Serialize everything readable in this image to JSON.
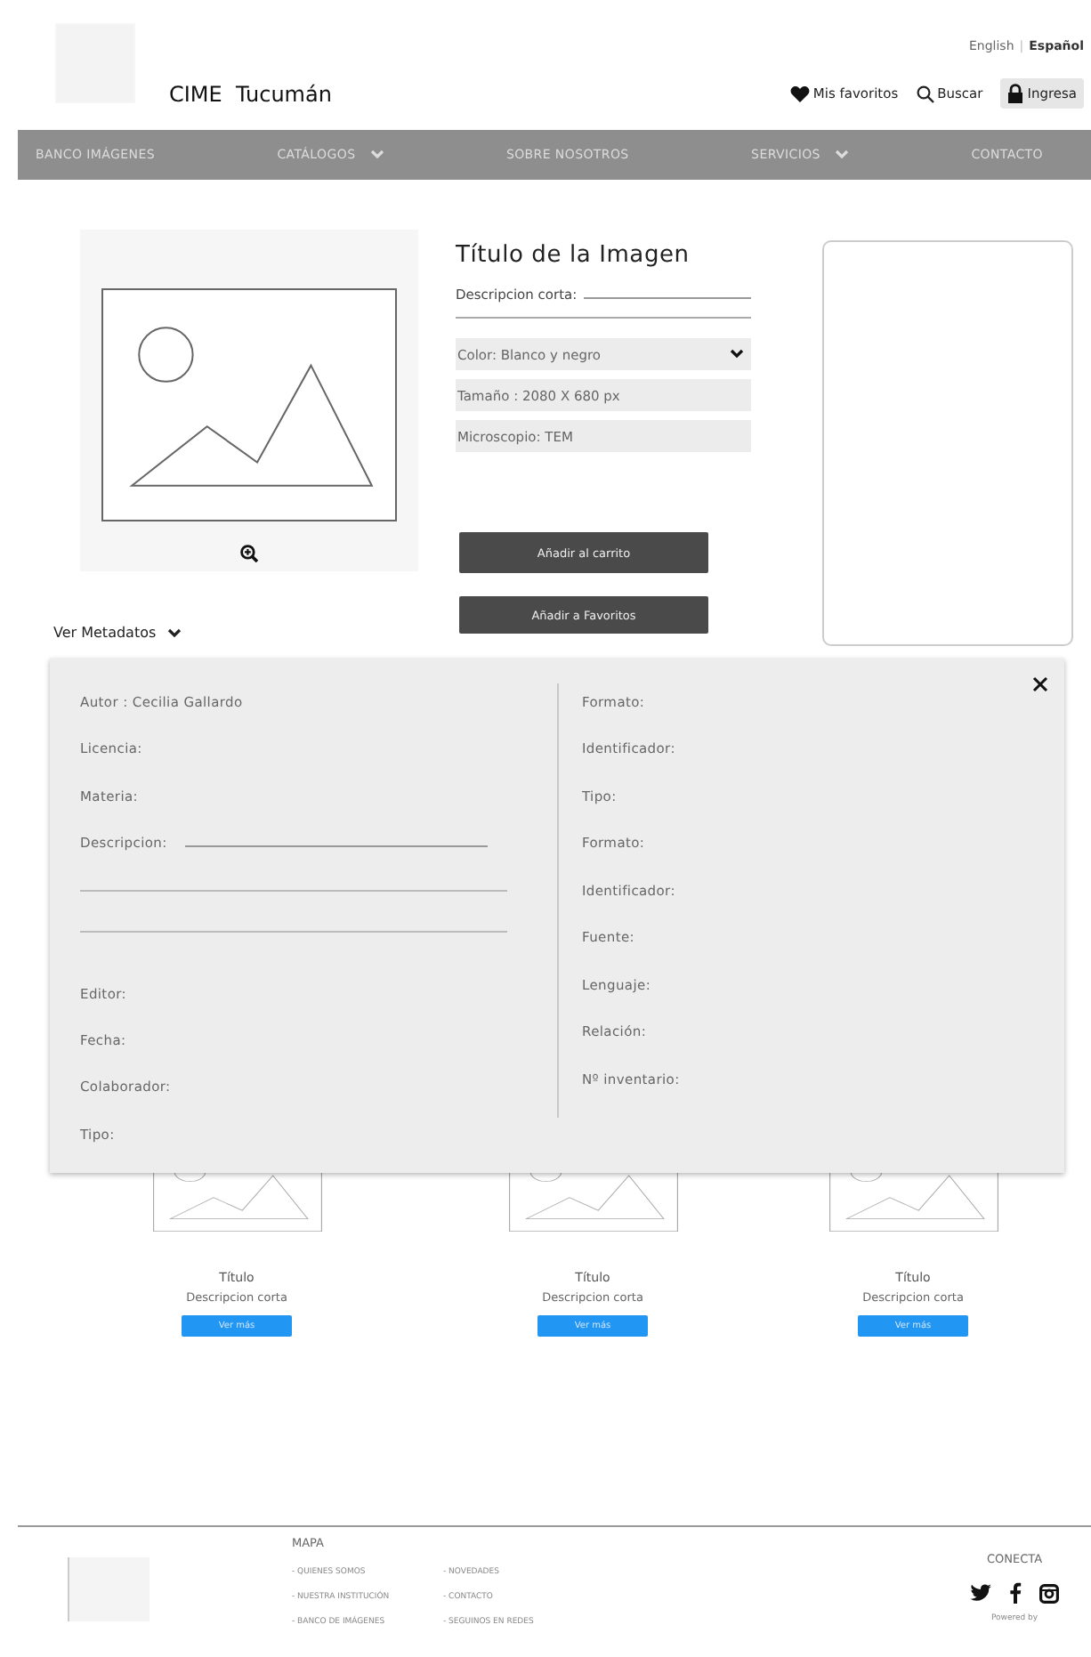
{
  "header": {
    "site_name": "CIME  Tucumán",
    "languages": [
      {
        "label": "English",
        "selected": false
      },
      {
        "label": "Español",
        "selected": true
      }
    ],
    "separator": "|",
    "actions": [
      {
        "kind": "favorites",
        "label": "Mis favoritos"
      },
      {
        "kind": "search",
        "label": "Buscar"
      },
      {
        "kind": "login",
        "label": "Ingresa"
      }
    ]
  },
  "nav": [
    {
      "label": "BANCO IMÁGENES",
      "has_menu": false
    },
    {
      "label": "CATÁLOGOS",
      "has_menu": true
    },
    {
      "label": "SOBRE NOSOTROS",
      "has_menu": false
    },
    {
      "label": "SERVICIOS",
      "has_menu": true
    },
    {
      "label": "CONTACTO",
      "has_menu": false
    }
  ],
  "image": {
    "title": "Título de la Imagen",
    "short_description_label": "Descripcion corta:",
    "options": [
      {
        "kind": "select",
        "text": "Color: Blanco y negro"
      },
      {
        "kind": "field",
        "text": "Tamaño : 2080 X 680 px"
      },
      {
        "kind": "field",
        "text": "Microscopio: TEM"
      }
    ],
    "buttons": [
      "Añadir al carrito",
      "Añadir a Favoritos"
    ]
  },
  "metadata_toggle": {
    "label": "Ver Metadatos",
    "expanded": true
  },
  "metadata": {
    "left": [
      {
        "kind": "plain",
        "label": "Autor : Cecilia Gallardo"
      },
      {
        "kind": "plain",
        "label": "Licencia:"
      },
      {
        "kind": "plain",
        "label": "Materia:"
      },
      {
        "kind": "multiline",
        "label": "Descripcion:"
      },
      {
        "kind": "plain",
        "label": "Editor:"
      },
      {
        "kind": "plain",
        "label": "Fecha:"
      },
      {
        "kind": "plain",
        "label": "Colaborador:"
      },
      {
        "kind": "plain",
        "label": "Tipo:"
      }
    ],
    "right": [
      {
        "kind": "plain",
        "label": "Formato:"
      },
      {
        "kind": "plain",
        "label": "Identificador:"
      },
      {
        "kind": "plain",
        "label": "Tipo:"
      },
      {
        "kind": "plain",
        "label": "Formato:"
      },
      {
        "kind": "plain",
        "label": "Identificador:"
      },
      {
        "kind": "plain",
        "label": "Fuente:"
      },
      {
        "kind": "plain",
        "label": "Lenguaje:"
      },
      {
        "kind": "plain",
        "label": "Relación:"
      },
      {
        "kind": "plain",
        "label": "Nº inventario:"
      }
    ]
  },
  "cards": [
    {
      "title": "Título",
      "description": "Descripcion corta",
      "button": "Ver más"
    },
    {
      "title": "Título",
      "description": "Descripcion corta",
      "button": "Ver más"
    },
    {
      "title": "Título",
      "description": "Descripcion corta",
      "button": "Ver más"
    }
  ],
  "footer": {
    "map_title": "MAPA",
    "links": [
      "- QUIENES SOMOS",
      "- NOVEDADES",
      "- NUESTRA INSTITUCIÓN",
      "- CONTACTO",
      "- BANCO DE IMÁGENES",
      "- SEGUINOS EN REDES"
    ],
    "connect_title": "CONECTA",
    "social": [
      {
        "kind": "twitter"
      },
      {
        "kind": "facebook"
      },
      {
        "kind": "instagram"
      }
    ],
    "powered": "Powered by"
  }
}
